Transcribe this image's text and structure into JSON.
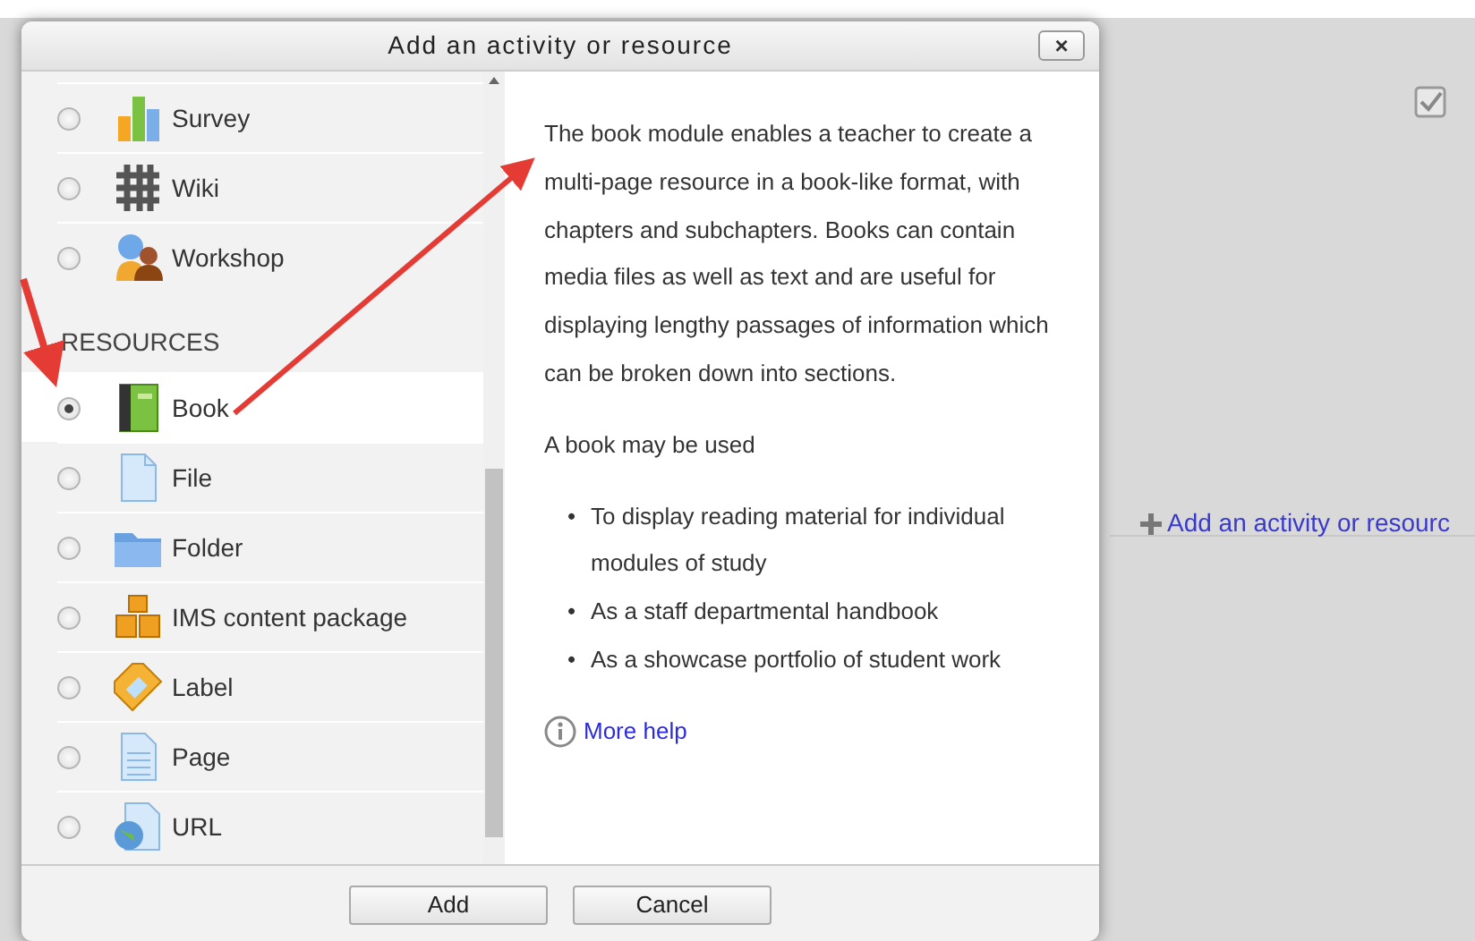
{
  "dialog": {
    "title": "Add an activity or resource",
    "close": "×",
    "modules": [
      {
        "kind": "item",
        "label": "Survey",
        "selected": false
      },
      {
        "kind": "item",
        "label": "Wiki",
        "selected": false
      },
      {
        "kind": "item",
        "label": "Workshop",
        "selected": false
      },
      {
        "kind": "heading",
        "label": "RESOURCES"
      },
      {
        "kind": "item",
        "label": "Book",
        "selected": true
      },
      {
        "kind": "item",
        "label": "File",
        "selected": false
      },
      {
        "kind": "item",
        "label": "Folder",
        "selected": false
      },
      {
        "kind": "item",
        "label": "IMS content package",
        "selected": false
      },
      {
        "kind": "item",
        "label": "Label",
        "selected": false
      },
      {
        "kind": "item",
        "label": "Page",
        "selected": false
      },
      {
        "kind": "item",
        "label": "URL",
        "selected": false
      }
    ],
    "description": {
      "paragraphs": [
        "The book module enables a teacher to create a multi-page resource in a book-like format, with chapters and subchapters. Books can contain media files as well as text and are useful for displaying lengthy passages of information which can be broken down into sections.",
        "A book may be used"
      ],
      "bullet_marker": "•",
      "bullets": [
        "To display reading material for individual modules of study",
        "As a staff departmental handbook",
        "As a showcase portfolio of student work"
      ],
      "help_link": "More help"
    },
    "buttons": [
      "Add",
      "Cancel"
    ]
  },
  "background_page": {
    "add_link": "Add an activity or resourc"
  }
}
